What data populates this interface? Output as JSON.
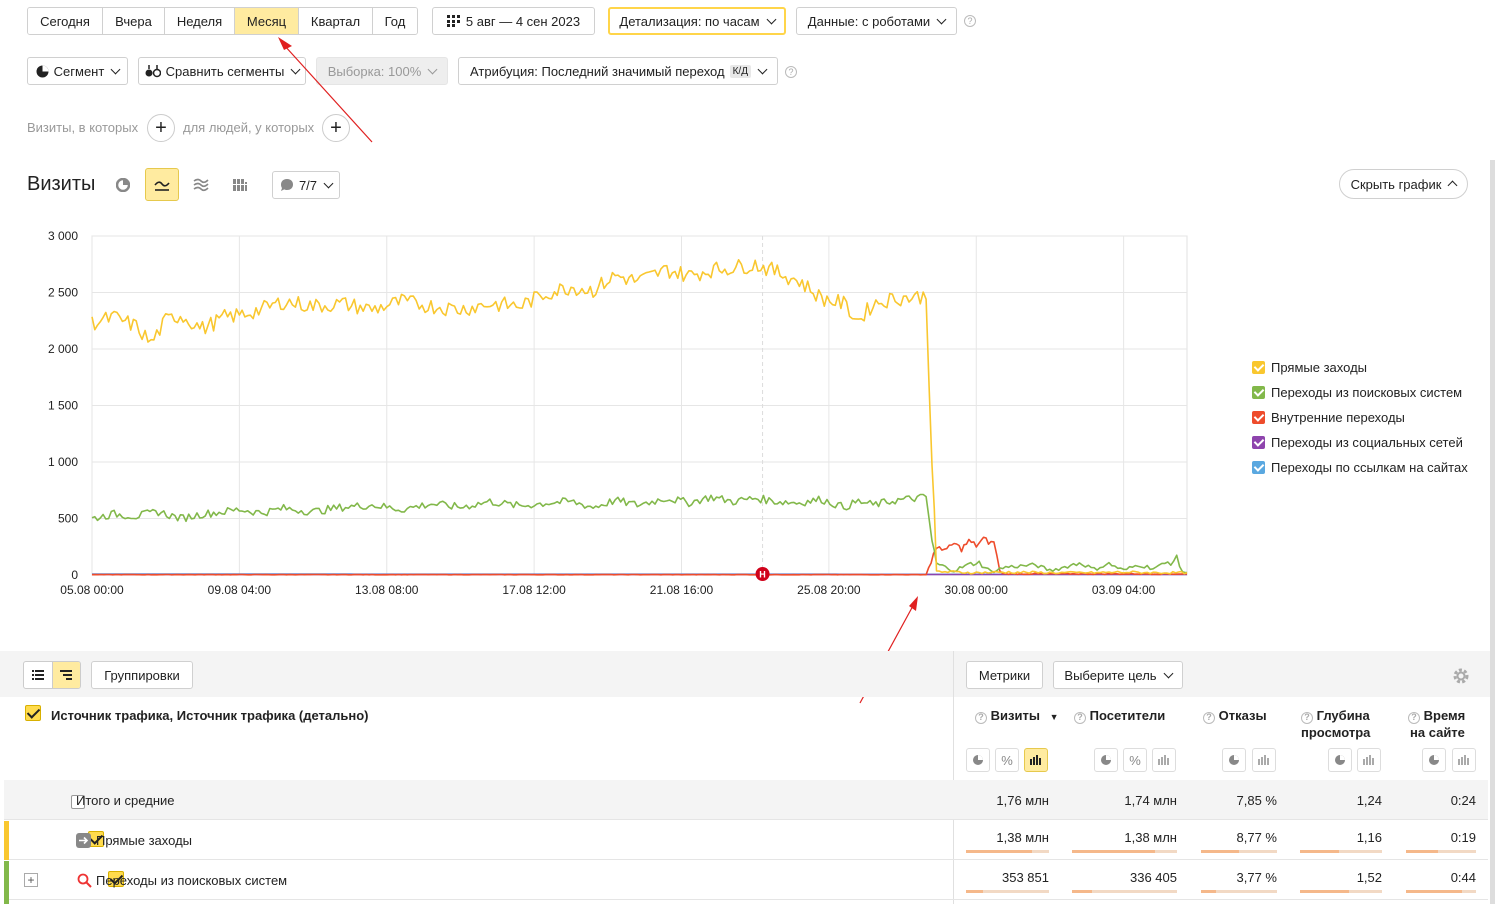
{
  "period_tabs": [
    {
      "label": "Сегодня",
      "active": false
    },
    {
      "label": "Вчера",
      "active": false
    },
    {
      "label": "Неделя",
      "active": false
    },
    {
      "label": "Месяц",
      "active": true
    },
    {
      "label": "Квартал",
      "active": false
    },
    {
      "label": "Год",
      "active": false
    }
  ],
  "date_range": "5 авг — 4 сен 2023",
  "detail": "Детализация: по часам",
  "data_mode": "Данные: с роботами",
  "segment": "Сегмент",
  "compare": "Сравнить сегменты",
  "sample": "Выборка: 100%",
  "attribution": "Атрибуция: Последний значимый переход",
  "attribution_badge": "К/Д",
  "filters": {
    "visits_label": "Визиты, в которых",
    "people_label": "для людей, у которых"
  },
  "chart_title": "Визиты",
  "series_counter": "7/7",
  "hide_chart": "Скрыть график",
  "colors": {
    "yellow": "#f9c72f",
    "green": "#82b84a",
    "red": "#ee4c2c",
    "purple": "#8e44ad",
    "blue": "#5aa8e0",
    "accent": "#ffeba0"
  },
  "chart_data": {
    "type": "line",
    "y_ticks": [
      "3 000",
      "2 500",
      "2 000",
      "1 500",
      "1 000",
      "500",
      "0"
    ],
    "ylim": [
      0,
      3000
    ],
    "x_ticks": [
      "05.08 00:00",
      "09.08 04:00",
      "13.08 08:00",
      "17.08 12:00",
      "21.08 16:00",
      "25.08 20:00",
      "30.08 00:00",
      "03.09 04:00"
    ],
    "x_tick_hours": [
      0,
      100,
      200,
      300,
      400,
      500,
      600,
      700
    ],
    "x_max_hours": 743,
    "marker_label": "Н",
    "marker_hour": 455,
    "series": [
      {
        "name": "Прямые заходы",
        "color": "#f9c72f",
        "points": [
          [
            0,
            2230
          ],
          [
            15,
            2280
          ],
          [
            30,
            2200
          ],
          [
            40,
            2050
          ],
          [
            50,
            2250
          ],
          [
            60,
            2300
          ],
          [
            75,
            2180
          ],
          [
            90,
            2280
          ],
          [
            100,
            2300
          ],
          [
            115,
            2350
          ],
          [
            130,
            2420
          ],
          [
            150,
            2380
          ],
          [
            170,
            2400
          ],
          [
            190,
            2350
          ],
          [
            210,
            2420
          ],
          [
            230,
            2380
          ],
          [
            250,
            2350
          ],
          [
            270,
            2400
          ],
          [
            290,
            2380
          ],
          [
            310,
            2500
          ],
          [
            325,
            2550
          ],
          [
            340,
            2520
          ],
          [
            355,
            2650
          ],
          [
            370,
            2600
          ],
          [
            390,
            2700
          ],
          [
            405,
            2650
          ],
          [
            420,
            2700
          ],
          [
            435,
            2720
          ],
          [
            450,
            2750
          ],
          [
            465,
            2680
          ],
          [
            480,
            2600
          ],
          [
            495,
            2450
          ],
          [
            510,
            2400
          ],
          [
            520,
            2250
          ],
          [
            530,
            2400
          ],
          [
            545,
            2450
          ],
          [
            560,
            2460
          ],
          [
            566,
            2470
          ],
          [
            570,
            1000
          ],
          [
            573,
            30
          ],
          [
            600,
            20
          ],
          [
            620,
            25
          ],
          [
            650,
            20
          ],
          [
            680,
            20
          ],
          [
            700,
            25
          ],
          [
            720,
            20
          ],
          [
            743,
            20
          ]
        ]
      },
      {
        "name": "Переходы из поисковых систем",
        "color": "#82b84a",
        "points": [
          [
            0,
            500
          ],
          [
            15,
            540
          ],
          [
            30,
            520
          ],
          [
            45,
            560
          ],
          [
            60,
            500
          ],
          [
            75,
            540
          ],
          [
            90,
            560
          ],
          [
            100,
            580
          ],
          [
            115,
            550
          ],
          [
            130,
            590
          ],
          [
            150,
            560
          ],
          [
            170,
            600
          ],
          [
            190,
            620
          ],
          [
            210,
            580
          ],
          [
            230,
            630
          ],
          [
            250,
            600
          ],
          [
            270,
            650
          ],
          [
            290,
            610
          ],
          [
            310,
            640
          ],
          [
            325,
            650
          ],
          [
            340,
            600
          ],
          [
            355,
            660
          ],
          [
            370,
            620
          ],
          [
            390,
            680
          ],
          [
            405,
            640
          ],
          [
            420,
            690
          ],
          [
            435,
            650
          ],
          [
            450,
            680
          ],
          [
            465,
            650
          ],
          [
            480,
            640
          ],
          [
            495,
            670
          ],
          [
            510,
            600
          ],
          [
            520,
            650
          ],
          [
            530,
            620
          ],
          [
            545,
            660
          ],
          [
            560,
            680
          ],
          [
            566,
            690
          ],
          [
            570,
            300
          ],
          [
            573,
            100
          ],
          [
            585,
            40
          ],
          [
            600,
            120
          ],
          [
            610,
            30
          ],
          [
            620,
            70
          ],
          [
            640,
            90
          ],
          [
            650,
            40
          ],
          [
            660,
            70
          ],
          [
            670,
            110
          ],
          [
            680,
            50
          ],
          [
            690,
            100
          ],
          [
            700,
            40
          ],
          [
            710,
            90
          ],
          [
            720,
            60
          ],
          [
            730,
            110
          ],
          [
            736,
            140
          ],
          [
            740,
            30
          ],
          [
            743,
            20
          ]
        ]
      },
      {
        "name": "Внутренние переходы",
        "color": "#ee4c2c",
        "points": [
          [
            0,
            3
          ],
          [
            566,
            3
          ],
          [
            571,
            180
          ],
          [
            575,
            250
          ],
          [
            580,
            220
          ],
          [
            585,
            280
          ],
          [
            590,
            230
          ],
          [
            595,
            300
          ],
          [
            600,
            260
          ],
          [
            605,
            320
          ],
          [
            610,
            280
          ],
          [
            612,
            300
          ],
          [
            616,
            30
          ],
          [
            620,
            10
          ],
          [
            743,
            10
          ]
        ]
      },
      {
        "name": "Переходы из социальных сетей",
        "color": "#8e44ad",
        "points": [
          [
            0,
            4
          ],
          [
            743,
            4
          ]
        ]
      },
      {
        "name": "Переходы по ссылкам на сайтах",
        "color": "#5aa8e0",
        "points": [
          [
            0,
            8
          ],
          [
            743,
            6
          ]
        ]
      }
    ]
  },
  "table": {
    "groupings_btn": "Группировки",
    "metrics_btn": "Метрики",
    "goal_btn": "Выберите цель",
    "dimension_header": "Источник трафика, Источник трафика (детально)",
    "columns": [
      {
        "name": "Визиты",
        "sorted": true,
        "sort_glyph": "▼"
      },
      {
        "name": "Посетители"
      },
      {
        "name": "Отказы"
      },
      {
        "name_line1": "Глубина",
        "name_line2": "просмотра"
      },
      {
        "name_line1": "Время",
        "name_line2": "на сайте"
      }
    ],
    "totals": {
      "label": "Итого и средние",
      "values": [
        "1,76 млн",
        "1,74 млн",
        "7,85 %",
        "1,24",
        "0:24"
      ]
    },
    "rows": [
      {
        "label": "Прямые заходы",
        "values": [
          "1,38 млн",
          "1,38 млн",
          "8,77 %",
          "1,16",
          "0:19"
        ],
        "share": [
          0.79,
          0.79,
          0.5,
          0.47,
          0.45
        ]
      },
      {
        "label": "Переходы из поисковых систем",
        "values": [
          "353 851",
          "336 405",
          "3,77 %",
          "1,52",
          "0:44"
        ],
        "share": [
          0.2,
          0.19,
          0.2,
          0.6,
          0.8
        ]
      }
    ]
  }
}
